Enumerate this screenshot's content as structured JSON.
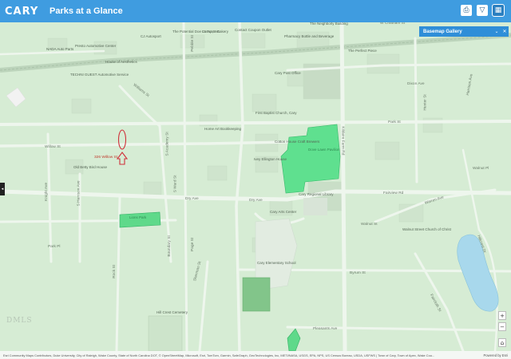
{
  "header": {
    "logo_text": "CARY",
    "app_title": "Parks at a Glance",
    "toolbar_icons": [
      "print-icon",
      "filter-icon",
      "basemap-gallery-icon"
    ]
  },
  "basemap_panel": {
    "title": "Basemap Gallery",
    "icons": [
      "minimize-icon",
      "close-icon"
    ]
  },
  "side_panel_toggle": "◂",
  "zoom_controls": {
    "zoom_in": "+",
    "zoom_out": "−",
    "home": "⌂"
  },
  "watermark": "DMLS",
  "map": {
    "places": {
      "nada": "NADA Auto Parts",
      "presto": "Presto Automotive Center",
      "house_aesthetics": "House of Aesthetics",
      "techni_guest": "TECHNI GUEST Automotive Service",
      "autosport": "CJ Autosport",
      "potential_doe": "The Potential Doe Group, Inc.",
      "la_fonte": "La Fonte Bakery",
      "contact_coupon": "Contact Coupon Outlet",
      "neighborly": "The Neighborly Building",
      "pharmacy": "Pharmacy Bottle and Beverage",
      "perfect_piece": "The Perfect Piece",
      "post_office": "Cary Post Office",
      "first_baptist": "First Baptist Church, Cary",
      "home_bookkeeping": "Home Art Bookkeeping",
      "cotton_house": "Cotton House Craft Brewers",
      "ivey_ellington": "Ivey Ellington House",
      "old_betty": "Old Betty Bird House",
      "green_lawn": "Dove Lawn Pavilion",
      "cary_arts": "Cary Arts Center",
      "regional_library": "Cary Regional Library",
      "elementary": "Cary Elementary School",
      "walnut_church": "Walnut Street Church of Christ",
      "hill_crest": "Hill Crest Cemetery",
      "lions": "Lions Park"
    },
    "roads": {
      "chatham": "W Chatham St",
      "webster": "Webster St",
      "hunter": "Hunter St",
      "harrison": "Harrison Ave",
      "williams": "Williams St",
      "park": "Park St",
      "willow": "Willow St",
      "dry_ave_1": "Dry Ave",
      "dry_ave_2": "Dry Ave",
      "fairview": "Fairview Rd",
      "walnut": "Walnut St",
      "warren": "Warren Ave",
      "walnut_pl": "Walnut Pl",
      "byrum": "Byrum St",
      "pleasants": "Pleasants Ave",
      "kildaire": "Kildaire Farm Rd",
      "faircloth": "Faircloth St",
      "knight": "Knight Ave",
      "hillcrest_dr": "Hillcrest Dr",
      "evans": "S Harrison Ave",
      "academy": "S Academy St",
      "boundary": "Boundary St",
      "park_pl": "Park Pl",
      "page": "Page St",
      "ward": "S Ward St",
      "rock": "Rock St",
      "sherman": "Sherman St",
      "dixon": "Dixon Ave",
      "pebble": "Pebble St"
    },
    "marker_label": "326 Willow St"
  },
  "footer": {
    "attribution": "Esri Community Maps Contributors, Duke University, City of Raleigh, Wake County, State of North Carolina DOT, © OpenStreetMap, Microsoft, Esri, TomTom, Garmin, SafeGraph, GeoTechnologies, Inc, METI/NASA, USGS, EPA, NPS, US Census Bureau, USDA, USFWS | Town of Cary, Town of Apex, Wake Cou...",
    "powered_by": "Powered by Esri"
  }
}
